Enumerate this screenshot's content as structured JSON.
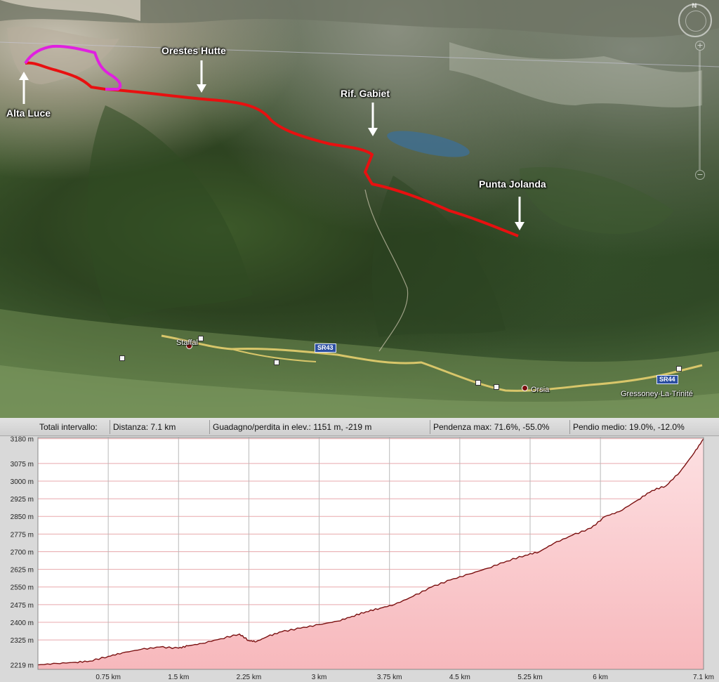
{
  "map": {
    "labels": {
      "alta_luce": "Alta Luce",
      "orestes_hutte": "Orestes Hutte",
      "rif_gabiet": "Rif. Gabiet",
      "punta_jolanda": "Punta Jolanda"
    },
    "places": {
      "staffal": "Staffal",
      "orsia": "Orsia",
      "gressoney": "Gressoney-La-Trinité"
    },
    "roads": {
      "sr43": "SR43",
      "sr44": "SR44"
    },
    "compass_letter": "N",
    "colors": {
      "route_main": "#e81010",
      "route_alt": "#e020e0",
      "road": "#d8c66a"
    }
  },
  "stats": {
    "interval_label": "Totali intervallo:",
    "distance": "Distanza: 7.1 km",
    "gain_loss": "Guadagno/perdita in elev.: 1151 m, -219 m",
    "max_slope": "Pendenza max: 71.6%, -55.0%",
    "avg_slope": "Pendio medio: 19.0%, -12.0%"
  },
  "chart_data": {
    "type": "area",
    "title": "",
    "xlabel": "",
    "ylabel": "",
    "xlim": [
      0,
      7.1
    ],
    "ylim": [
      2200,
      3185
    ],
    "y_ticks": [
      {
        "value": 2219,
        "label": "2219 m"
      },
      {
        "value": 2325,
        "label": "2325 m"
      },
      {
        "value": 2400,
        "label": "2400 m"
      },
      {
        "value": 2475,
        "label": "2475 m"
      },
      {
        "value": 2550,
        "label": "2550 m"
      },
      {
        "value": 2625,
        "label": "2625 m"
      },
      {
        "value": 2700,
        "label": "2700 m"
      },
      {
        "value": 2775,
        "label": "2775 m"
      },
      {
        "value": 2850,
        "label": "2850 m"
      },
      {
        "value": 2925,
        "label": "2925 m"
      },
      {
        "value": 3000,
        "label": "3000 m"
      },
      {
        "value": 3075,
        "label": "3075 m"
      },
      {
        "value": 3180,
        "label": "3180 m"
      }
    ],
    "x_ticks": [
      {
        "value": 0.75,
        "label": "0.75 km"
      },
      {
        "value": 1.5,
        "label": "1.5 km"
      },
      {
        "value": 2.25,
        "label": "2.25 km"
      },
      {
        "value": 3,
        "label": "3 km"
      },
      {
        "value": 3.75,
        "label": "3.75 km"
      },
      {
        "value": 4.5,
        "label": "4.5 km"
      },
      {
        "value": 5.25,
        "label": "5.25 km"
      },
      {
        "value": 6,
        "label": "6 km"
      },
      {
        "value": 7.1,
        "label": "7.1 km"
      }
    ],
    "x": [
      0,
      0.2,
      0.4,
      0.55,
      0.75,
      0.9,
      1.1,
      1.3,
      1.5,
      1.6,
      1.75,
      1.95,
      2.15,
      2.25,
      2.33,
      2.45,
      2.6,
      2.8,
      3.0,
      3.2,
      3.35,
      3.5,
      3.65,
      3.8,
      4.0,
      4.2,
      4.4,
      4.6,
      4.8,
      5.0,
      5.2,
      5.35,
      5.5,
      5.7,
      5.9,
      6.05,
      6.2,
      6.4,
      6.55,
      6.7,
      6.85,
      7.0,
      7.1
    ],
    "series": [
      {
        "color": "#7a1010",
        "fill": "#f7b8bc",
        "values": [
          2219,
          2225,
          2230,
          2235,
          2255,
          2270,
          2285,
          2295,
          2290,
          2300,
          2310,
          2330,
          2350,
          2322,
          2318,
          2340,
          2360,
          2375,
          2390,
          2405,
          2425,
          2445,
          2460,
          2475,
          2510,
          2550,
          2580,
          2605,
          2630,
          2660,
          2685,
          2700,
          2735,
          2770,
          2800,
          2850,
          2870,
          2920,
          2960,
          2980,
          3040,
          3120,
          3180
        ]
      }
    ]
  }
}
